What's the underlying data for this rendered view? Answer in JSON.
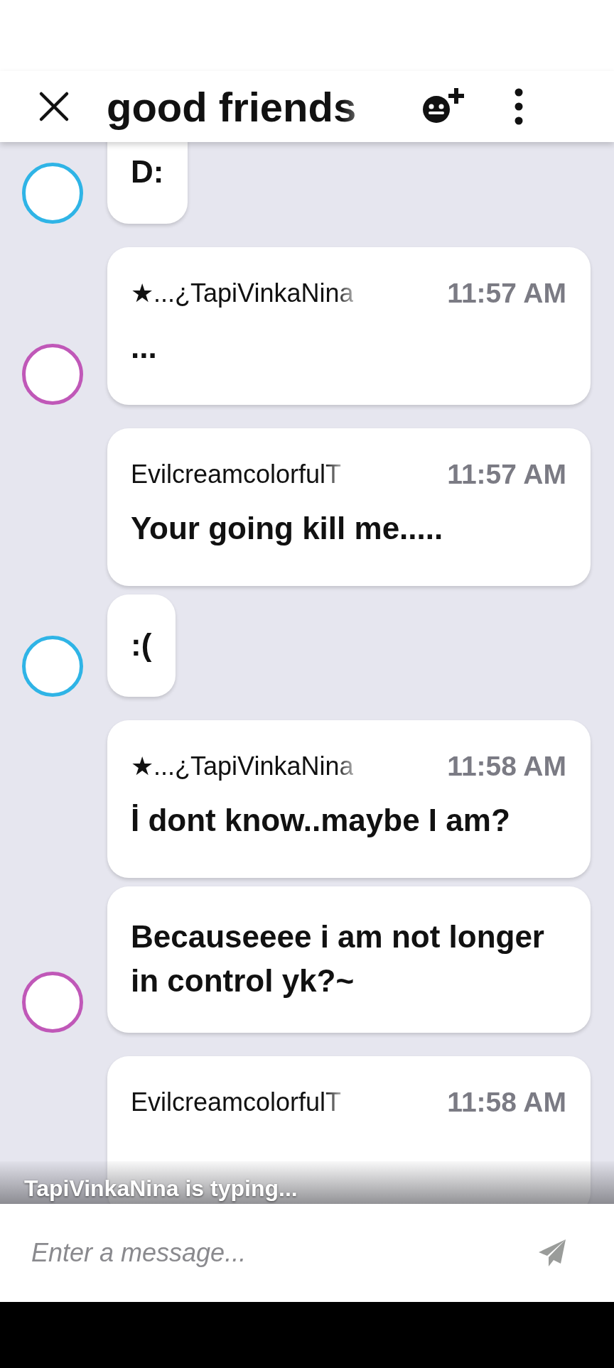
{
  "header": {
    "title": "good friends"
  },
  "messages": [
    {
      "text": "D:",
      "color": "#2fb4e6"
    },
    {
      "name": "★...¿TapiVinkaNina",
      "time": "11:57 AM",
      "text": "...",
      "color": "#c058b8"
    },
    {
      "name": "EvilcreamcolorfulT",
      "time": "11:57 AM",
      "text": "Your going kill me....."
    },
    {
      "text": ":(",
      "color": "#2fb4e6"
    },
    {
      "name": "★...¿TapiVinkaNina",
      "time": "11:58 AM",
      "text": "İ dont know..maybe I am?"
    },
    {
      "text": "Becauseeee i am not longer in control yk?~",
      "color": "#c058b8"
    },
    {
      "name": "EvilcreamcolorfulT",
      "time": "11:58 AM"
    }
  ],
  "typing_indicator": "TapiVinkaNina is typing...",
  "composer": {
    "placeholder": "Enter a message..."
  }
}
